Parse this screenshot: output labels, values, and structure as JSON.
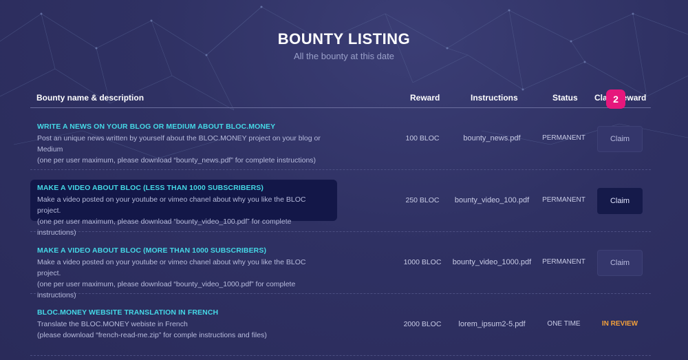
{
  "header": {
    "title": "BOUNTY LISTING",
    "subtitle": "All the bounty at this date"
  },
  "columns": {
    "name": "Bounty name & description",
    "reward": "Reward",
    "instructions": "Instructions",
    "status": "Status",
    "claim": "Claim reward"
  },
  "rows": [
    {
      "title": "WRITE A NEWS ON YOUR BLOG OR MEDIUM ABOUT BLOC.MONEY",
      "line1": "Post an unique news written by yourself about the BLOC.MONEY project on your blog or Medium",
      "line2": "(one per user maximum, please download “bounty_news.pdf” for complete instructions)",
      "reward": "100 BLOC",
      "instructions": "bounty_news.pdf",
      "status": "PERMANENT",
      "claim": "Claim"
    },
    {
      "title": "MAKE A VIDEO ABOUT BLOC (LESS THAN 1000 SUBSCRIBERS)",
      "line1": "Make a video posted on your youtube or vimeo chanel about why you like the BLOC project.",
      "line2": "(one per user maximum, please download “bounty_video_100.pdf” for complete instructions)",
      "reward": "250 BLOC",
      "instructions": "bounty_video_100.pdf",
      "status": "PERMANENT",
      "claim": "Claim"
    },
    {
      "title": "MAKE A VIDEO ABOUT BLOC (MORE THAN 1000 SUBSCRIBERS)",
      "line1": "Make a video posted on your youtube or vimeo chanel about why you like the BLOC project.",
      "line2": "(one per user maximum, please download “bounty_video_1000.pdf” for complete instructions)",
      "reward": "1000 BLOC",
      "instructions": "bounty_video_1000.pdf",
      "status": "PERMANENT",
      "claim": "Claim"
    },
    {
      "title": "BLOC.MONEY WEBSITE TRANSLATION IN FRENCH",
      "line1": "Translate the BLOC.MONEY webiste in French",
      "line2": "(please download “french-read-me.zip” for comple instructions and files)",
      "reward": "2000 BLOC",
      "instructions": "lorem_ipsum2-5.pdf",
      "status": "ONE TIME",
      "claim_status": "IN REVIEW"
    }
  ],
  "annotation_badge": "2",
  "colors": {
    "accent_title": "#45d8e6",
    "review": "#f2a03a",
    "badge": "#e6177c",
    "active_row": "#131748"
  }
}
